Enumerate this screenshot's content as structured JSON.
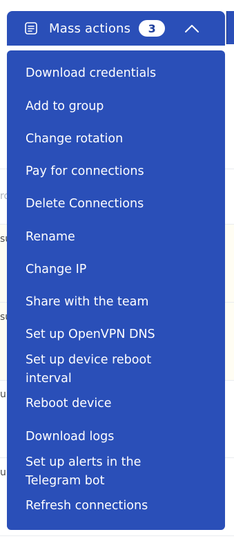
{
  "mass_actions": {
    "label": "Mass actions",
    "count": "3"
  },
  "background": {
    "partial_row_texts": [
      "ro",
      "su",
      "su",
      "up",
      "up"
    ]
  },
  "menu": {
    "items": [
      {
        "label": "Download credentials"
      },
      {
        "label": "Add to group"
      },
      {
        "label": "Change rotation"
      },
      {
        "label": "Pay for connections"
      },
      {
        "label": "Delete Connections"
      },
      {
        "label": "Rename"
      },
      {
        "label": "Change IP"
      },
      {
        "label": "Share with the team"
      },
      {
        "label": "Set up OpenVPN DNS"
      },
      {
        "label": "Set up device reboot interval"
      },
      {
        "label": "Reboot device"
      },
      {
        "label": "Download logs"
      },
      {
        "label": "Set up alerts in the Telegram bot"
      },
      {
        "label": "Refresh connections"
      }
    ]
  },
  "colors": {
    "primary": "#2a4fb8",
    "text_on_primary": "#ffffff",
    "badge_text": "#1e3f9c"
  },
  "icons": {
    "list": "list-icon",
    "collapse": "chevron-up-icon"
  }
}
